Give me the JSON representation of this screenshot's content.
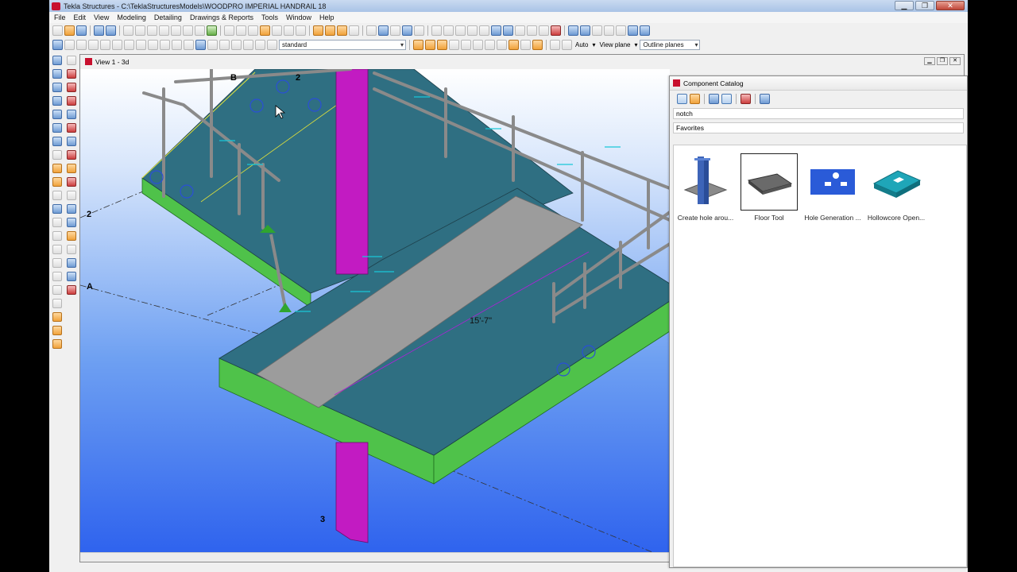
{
  "window": {
    "title": "Tekla Structures - C:\\TeklaStructuresModels\\WOODPRO IMPERIAL HANDRAIL 18",
    "controls": [
      "▁",
      "❐",
      "✕"
    ]
  },
  "menu": [
    "File",
    "Edit",
    "View",
    "Modeling",
    "Detailing",
    "Drawings & Reports",
    "Tools",
    "Window",
    "Help"
  ],
  "toolbar2": {
    "filter_select": "standard",
    "snap_mode": "Auto",
    "plane": "View plane",
    "planes_display": "Outline planes"
  },
  "view": {
    "title": "View 1 - 3d",
    "grid_labels": {
      "b": "B",
      "two_top": "2",
      "two_left": "2",
      "a": "A",
      "three": "3"
    },
    "dimension": "15'-7\""
  },
  "catalog": {
    "title": "Component Catalog",
    "search_value": "notch",
    "group": "Favorites",
    "items": [
      {
        "label": "Create hole arou...",
        "icon": "column-hole-icon"
      },
      {
        "label": "Floor Tool",
        "icon": "floor-slab-icon",
        "selected": true
      },
      {
        "label": "Hole Generation ...",
        "icon": "hole-generation-icon"
      },
      {
        "label": "Hollowcore Open...",
        "icon": "hollowcore-opening-icon"
      }
    ]
  },
  "colors": {
    "deck": "#2f6f82",
    "beam_green": "#4fc24a",
    "column_magenta": "#c21bc2",
    "walkway": "#9c9c9c",
    "rail": "#8a8a8a"
  }
}
